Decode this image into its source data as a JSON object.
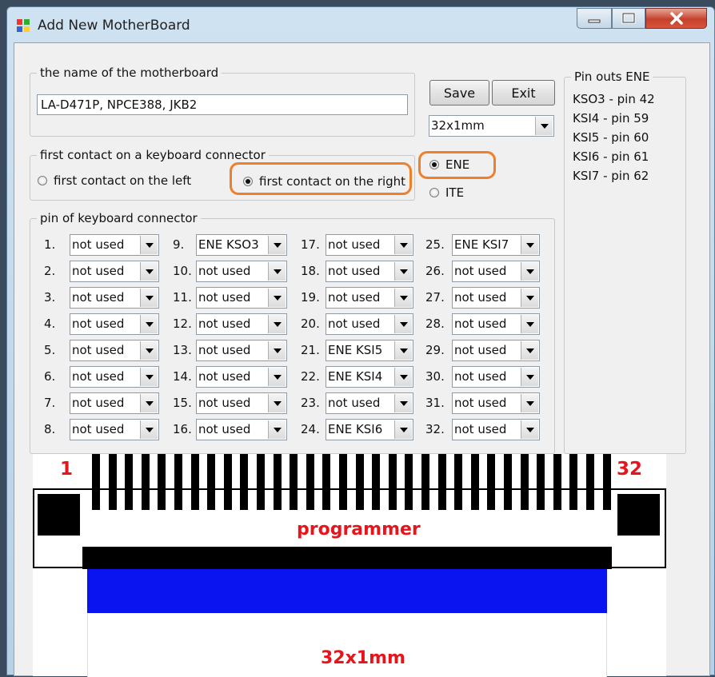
{
  "window": {
    "title": "Add New MotherBoard",
    "minimize_label": "—",
    "maximize_label": "☐",
    "close_label": "✕"
  },
  "name_group": {
    "label": "the name of the motherboard",
    "value": "LA-D471P, NPCE388, JKB2"
  },
  "buttons": {
    "save": "Save",
    "exit": "Exit"
  },
  "size_combo": {
    "value": "32x1mm"
  },
  "contact_group": {
    "label": "first contact on a keyboard connector",
    "left_option": "first contact on the left",
    "right_option": "first contact on the right",
    "selected": "right"
  },
  "chip": {
    "ene": "ENE",
    "ite": "ITE",
    "selected": "ENE"
  },
  "pinouts": {
    "label": "Pin outs ENE",
    "lines": [
      "KSO3 - pin 42",
      "KSI4   - pin 59",
      "KSI5   - pin 60",
      "KSI6   - pin 61",
      "KSI7   - pin 62"
    ]
  },
  "pins_group": {
    "label": "pin of keyboard connector",
    "columns": [
      [
        {
          "num": "1.",
          "value": "not used"
        },
        {
          "num": "2.",
          "value": "not used"
        },
        {
          "num": "3.",
          "value": "not used"
        },
        {
          "num": "4.",
          "value": "not used"
        },
        {
          "num": "5.",
          "value": "not used"
        },
        {
          "num": "6.",
          "value": "not used"
        },
        {
          "num": "7.",
          "value": "not used"
        },
        {
          "num": "8.",
          "value": "not used"
        }
      ],
      [
        {
          "num": "9.",
          "value": "ENE KSO3"
        },
        {
          "num": "10.",
          "value": "not used"
        },
        {
          "num": "11.",
          "value": "not used"
        },
        {
          "num": "12.",
          "value": "not used"
        },
        {
          "num": "13.",
          "value": "not used"
        },
        {
          "num": "14.",
          "value": "not used"
        },
        {
          "num": "15.",
          "value": "not used"
        },
        {
          "num": "16.",
          "value": "not used"
        }
      ],
      [
        {
          "num": "17.",
          "value": "not used"
        },
        {
          "num": "18.",
          "value": "not used"
        },
        {
          "num": "19.",
          "value": "not used"
        },
        {
          "num": "20.",
          "value": "not used"
        },
        {
          "num": "21.",
          "value": "ENE KSI5"
        },
        {
          "num": "22.",
          "value": "ENE KSI4"
        },
        {
          "num": "23.",
          "value": "not used"
        },
        {
          "num": "24.",
          "value": "ENE KSI6"
        }
      ],
      [
        {
          "num": "25.",
          "value": "ENE KSI7"
        },
        {
          "num": "26.",
          "value": "not used"
        },
        {
          "num": "27.",
          "value": "not used"
        },
        {
          "num": "28.",
          "value": "not used"
        },
        {
          "num": "29.",
          "value": "not used"
        },
        {
          "num": "30.",
          "value": "not used"
        },
        {
          "num": "31.",
          "value": "not used"
        },
        {
          "num": "32.",
          "value": "not used"
        }
      ]
    ]
  },
  "diagram": {
    "first_pin": "1",
    "last_pin": "32",
    "programmer_label": "programmer",
    "size_label": "32x1mm",
    "accent_red": "#e8141c",
    "cable_blue": "#0a14f0"
  },
  "colors": {
    "highlight": "#ef7f2b"
  }
}
